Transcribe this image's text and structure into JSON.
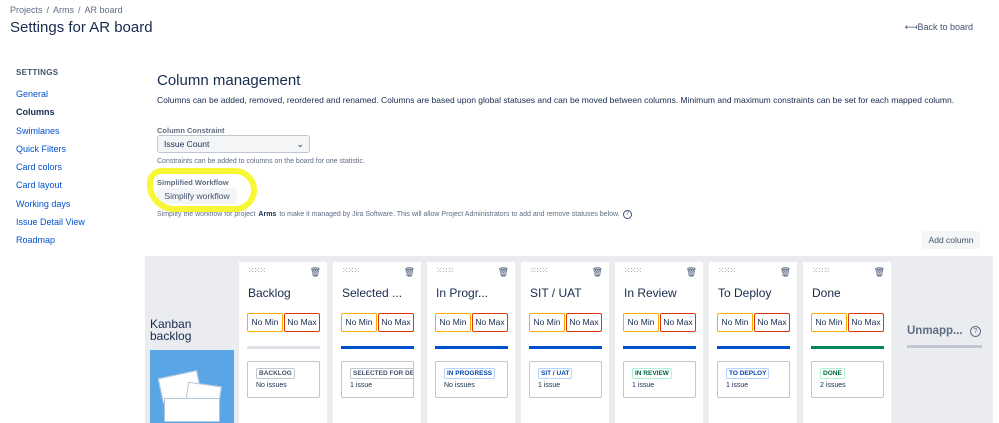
{
  "breadcrumb": [
    "Projects",
    "Arms",
    "AR board"
  ],
  "page_title": "Settings for AR board",
  "back_link": "⟻Back to board",
  "sidebar": {
    "heading": "SETTINGS",
    "items": [
      "General",
      "Columns",
      "Swimlanes",
      "Quick Filters",
      "Card colors",
      "Card layout",
      "Working days",
      "Issue Detail View",
      "Roadmap"
    ],
    "active": "Columns"
  },
  "main": {
    "title": "Column management",
    "description": "Columns can be added, removed, reordered and renamed. Columns are based upon global statuses and can be moved between columns. Minimum and maximum constraints can be set for each mapped column.",
    "constraint_label": "Column Constraint",
    "constraint_value": "Issue Count",
    "constraint_help": "Constraints can be added to columns on the board for one statistic.",
    "simplified_label": "Simplified Workflow",
    "simplify_button": "Simplify workflow",
    "simplify_help_pre": "Simplify the workflow for project",
    "simplify_help_project": "Arms",
    "simplify_help_post": "to make it managed by Jira Software. This will allow Project Administrators to add and remove statuses below.",
    "add_column": "Add column"
  },
  "board": {
    "kanban_backlog": "Kanban backlog",
    "unmapped": "Unmapp...",
    "columns": [
      {
        "name": "Backlog",
        "min": "No Min",
        "max": "No Max",
        "bar_color": "#dfe1e6",
        "status": "BACKLOG",
        "status_style": "gray",
        "count": "No issues"
      },
      {
        "name": "Selected ...",
        "min": "No Min",
        "max": "No Max",
        "bar_color": "#0052cc",
        "status": "SELECTED FOR DEVELOPMENT",
        "status_style": "gray",
        "count": "1 issue"
      },
      {
        "name": "In Progr...",
        "min": "No Min",
        "max": "No Max",
        "bar_color": "#0052cc",
        "status": "IN PROGRESS",
        "status_style": "blue",
        "count": "No issues"
      },
      {
        "name": "SIT / UAT",
        "min": "No Min",
        "max": "No Max",
        "bar_color": "#0052cc",
        "status": "SIT / UAT",
        "status_style": "blue",
        "count": "1 issue"
      },
      {
        "name": "In Review",
        "min": "No Min",
        "max": "No Max",
        "bar_color": "#0052cc",
        "status": "IN REVIEW",
        "status_style": "green",
        "count": "1 issue"
      },
      {
        "name": "To Deploy",
        "min": "No Min",
        "max": "No Max",
        "bar_color": "#0052cc",
        "status": "TO DEPLOY",
        "status_style": "blue",
        "count": "1 issue"
      },
      {
        "name": "Done",
        "min": "No Min",
        "max": "No Max",
        "bar_color": "#00875a",
        "status": "DONE",
        "status_style": "green",
        "count": "2 issues"
      }
    ]
  },
  "colors": {
    "link": "#0052cc",
    "highlight": "#f7f72a",
    "min_border": "#ffab00",
    "max_border": "#de350b"
  }
}
